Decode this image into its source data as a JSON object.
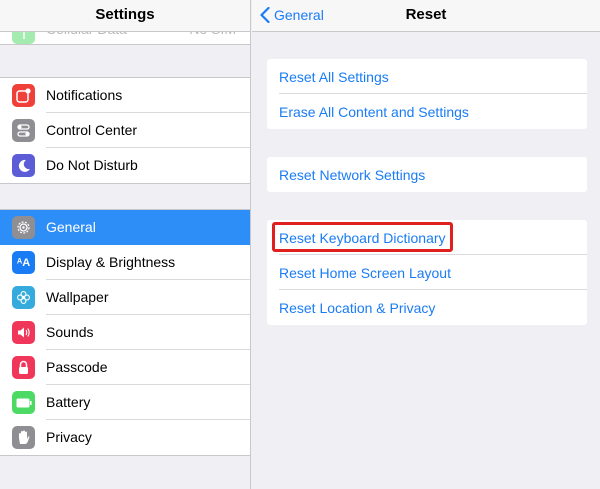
{
  "master": {
    "title": "Settings",
    "partial_item": {
      "label": "Cellular Data",
      "value": "No SIM",
      "icon": "antenna-icon",
      "color": "#4cd964"
    },
    "group1": [
      {
        "label": "Notifications",
        "icon": "notifications-icon",
        "color": "#f0403a"
      },
      {
        "label": "Control Center",
        "icon": "control-center-icon",
        "color": "#8e8e93"
      },
      {
        "label": "Do Not Disturb",
        "icon": "moon-icon",
        "color": "#5c5cd6"
      }
    ],
    "group2": [
      {
        "label": "General",
        "icon": "gear-icon",
        "color": "#8e8e93",
        "selected": true
      },
      {
        "label": "Display & Brightness",
        "icon": "display-brightness-icon",
        "color": "#1a7cf5"
      },
      {
        "label": "Wallpaper",
        "icon": "wallpaper-icon",
        "color": "#35aadc"
      },
      {
        "label": "Sounds",
        "icon": "speaker-icon",
        "color": "#f0375a"
      },
      {
        "label": "Passcode",
        "icon": "lock-icon",
        "color": "#f0375a"
      },
      {
        "label": "Battery",
        "icon": "battery-icon",
        "color": "#4cd964"
      },
      {
        "label": "Privacy",
        "icon": "hand-icon",
        "color": "#8e8e93"
      }
    ]
  },
  "detail": {
    "back_label": "General",
    "title": "Reset",
    "group1": [
      "Reset All Settings",
      "Erase All Content and Settings"
    ],
    "group2": [
      "Reset Network Settings"
    ],
    "group3": [
      "Reset Keyboard Dictionary",
      "Reset Home Screen Layout",
      "Reset Location & Privacy"
    ],
    "highlighted_item": "Reset Keyboard Dictionary",
    "highlight_color": "#e0201f",
    "link_color": "#1a7cf5",
    "selected_color": "#2d8ef7"
  }
}
